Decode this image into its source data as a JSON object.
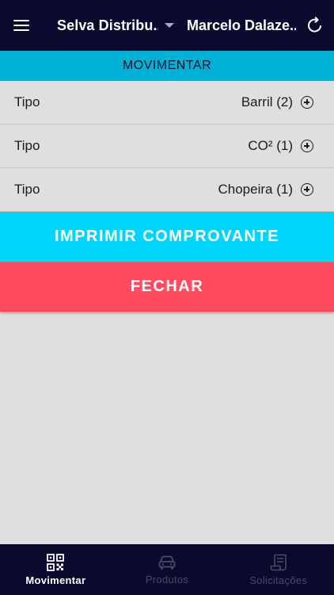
{
  "topbar": {
    "company": "Selva Distribu...",
    "user": "Marcelo Dalaze.."
  },
  "section": {
    "title": "MOVIMENTAR"
  },
  "items": [
    {
      "type_label": "Tipo",
      "label": "Barril (2)",
      "icon": "add-circle-icon"
    },
    {
      "type_label": "Tipo",
      "label": "CO² (1)",
      "icon": "add-circle-icon"
    },
    {
      "type_label": "Tipo",
      "label": "Chopeira (1)",
      "icon": "add-circle-icon"
    }
  ],
  "actions": {
    "print_label": "IMPRIMIR COMPROVANTE",
    "close_label": "FECHAR"
  },
  "bottom_nav": [
    {
      "label": "Movimentar",
      "icon": "qr-code-icon",
      "active": true
    },
    {
      "label": "Produtos",
      "icon": "car-icon",
      "active": false
    },
    {
      "label": "Solicitações",
      "icon": "receipt-icon",
      "active": false
    }
  ],
  "colors": {
    "nav_bg": "#0b0a2e",
    "section_header": "#00b3d6",
    "print_button": "#00d6fb",
    "close_button": "#ff4b5f",
    "background": "#dfdfdf"
  }
}
